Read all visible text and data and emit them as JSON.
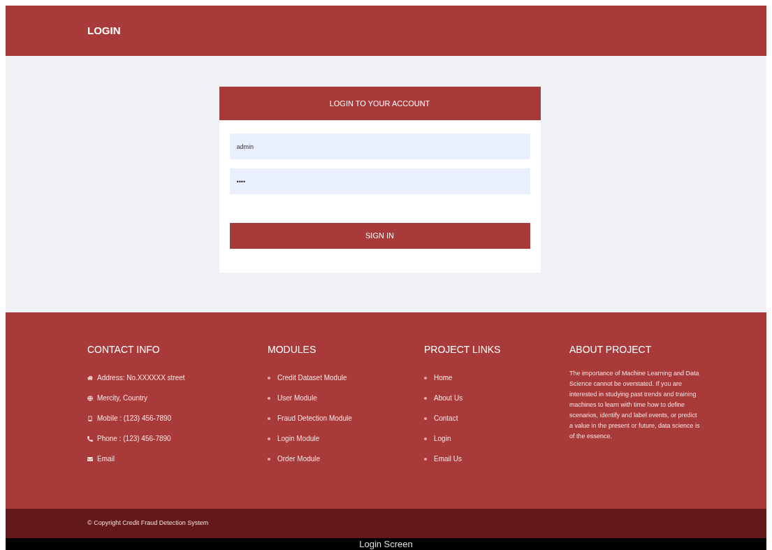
{
  "header": {
    "title": "LOGIN"
  },
  "login_card": {
    "title": "LOGIN TO YOUR ACCOUNT",
    "username": {
      "value": "admin"
    },
    "password": {
      "value": "••••"
    },
    "button": "SIGN IN"
  },
  "footer": {
    "contact": {
      "heading": "CONTACT INFO",
      "items": [
        {
          "kind": "home",
          "text": "Address: No.XXXXXX street"
        },
        {
          "kind": "globe",
          "text": "Mercity, Country"
        },
        {
          "kind": "mobile",
          "text": "Mobile : (123) 456-7890"
        },
        {
          "kind": "phone",
          "text": "Phone : (123) 456-7890"
        },
        {
          "kind": "mail",
          "text": "Email"
        }
      ]
    },
    "modules": {
      "heading": "MODULES",
      "items": [
        "Credit Dataset Module",
        "User Module",
        "Fraud Detection Module",
        "Login Module",
        "Order Module"
      ]
    },
    "links": {
      "heading": "PROJECT LINKS",
      "items": [
        "Home",
        "About Us",
        "Contact",
        "Login",
        "Email Us"
      ]
    },
    "about": {
      "heading": "ABOUT PROJECT",
      "text": "The importance of Machine Learning and Data Science cannot be overstated. If you are interested in studying past trends and training machines to learn with time how to define scenarios, identify and label events, or predict a value in the present or future, data science is of the essence."
    }
  },
  "copyright": "© Copyright Credit Fraud Detection System",
  "caption": "Login Screen"
}
